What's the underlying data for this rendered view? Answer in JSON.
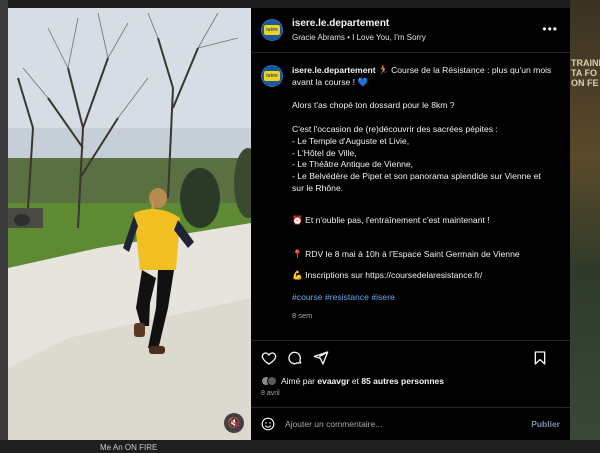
{
  "post": {
    "username": "isere.le.departement",
    "avatar_label": "isère",
    "audio": "Gracie Abrams • I Love You, I'm Sorry",
    "more_label": "•••",
    "caption": {
      "username": "isere.le.departement",
      "line1": " 🏃 Course de la Résistance : plus qu'un mois avant la course ! 💙",
      "line2": "Alors t'as chopé ton dossard pour le 8km ?",
      "line3": "C'est l'occasion de (re)découvrir des sacrées pépites :",
      "list": [
        "- Le Temple d'Auguste et Livie,",
        "- L'Hôtel de Ville,",
        "- Le Théâtre Antique de Vienne,",
        "- Le Belvédère de Pipet et son panorama splendide sur Vienne et sur le Rhône."
      ],
      "line4": "⏰ Et n'oublie pas, l'entraînement c'est maintenant !",
      "line5": "📍 RDV le 8 mai à 10h à l'Espace Saint Germain de Vienne",
      "line6": "💪 Inscriptions sur https://coursedelaresistance.fr/",
      "hashtags": [
        "#course",
        "#resistance",
        "#isere"
      ],
      "age": "8 sem"
    },
    "likes": {
      "prefix": "Aimé par ",
      "user": "evaavgr",
      "middle": " et ",
      "count": "85 autres personnes"
    },
    "date": "8 avril",
    "comment": {
      "placeholder": "Ajouter un commentaire...",
      "publish": "Publier"
    }
  },
  "background": {
    "right_text": "TRAINE\nTA FO\nON FE",
    "bottom_text": "Me An ON FIRE"
  },
  "icons": [
    "heart-icon",
    "comment-icon",
    "share-icon",
    "bookmark-icon",
    "emoji-icon",
    "mute-icon",
    "more-icon"
  ],
  "colors": {
    "link": "#6ea6f0",
    "background": "#000000",
    "publish": "#7a8fb0",
    "shirt": "#f0c020"
  }
}
